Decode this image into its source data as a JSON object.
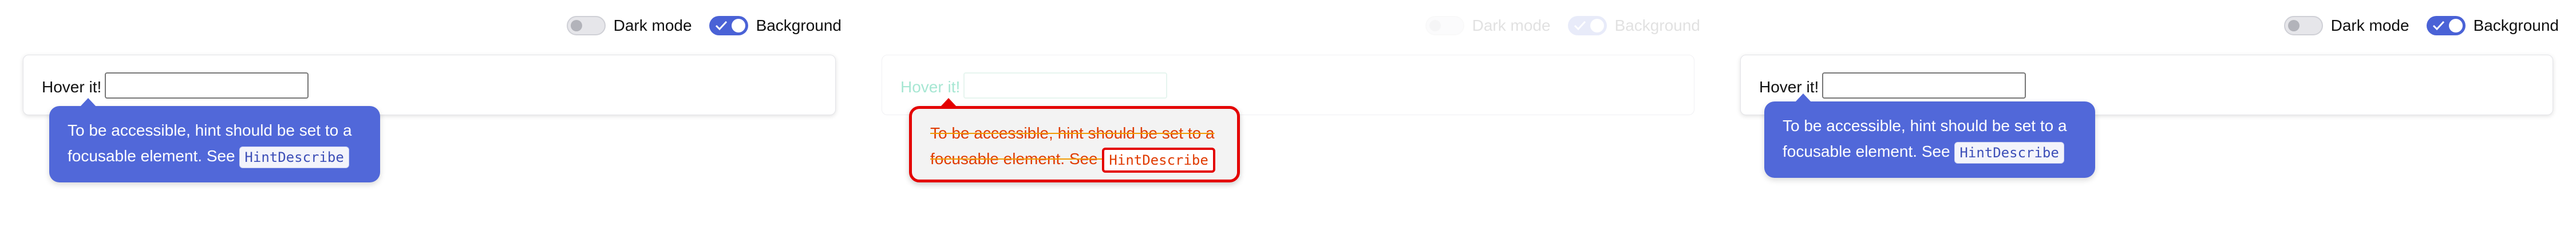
{
  "toggles": {
    "dark_mode_label": "Dark mode",
    "background_label": "Background",
    "dark_mode_on": false,
    "background_on": true
  },
  "demo": {
    "label": "Hover it!",
    "input_value": ""
  },
  "tooltip": {
    "text": "To be accessible, hint should be set to a focusable element. See",
    "code": "HintDescribe"
  },
  "colors": {
    "accent": "#4a62d6",
    "tooltip_bg": "#5168d9",
    "contrast_red": "#e40000",
    "contrast_orange": "#e03b00"
  }
}
